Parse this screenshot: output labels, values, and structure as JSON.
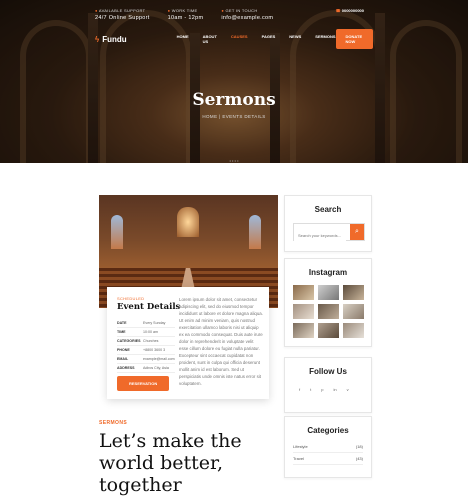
{
  "topbar": {
    "support_label": "AVAILABLE SUPPORT",
    "support_value": "24/7 Online Support",
    "work_label": "WORK TIME",
    "work_value": "10am - 12pm",
    "touch_label": "GET IN TOUCH",
    "touch_value": "info@example.com",
    "phone": "0000000000"
  },
  "nav": {
    "logo": "Fundu",
    "items": [
      "HOME",
      "ABOUT US",
      "CAUSES",
      "PAGES",
      "NEWS",
      "SERMONS"
    ],
    "active_index": 2,
    "donate": "DONATE NOW"
  },
  "hero": {
    "title": "Sermons",
    "breadcrumb": "HOME | EVENTS DETAILS",
    "dots": "• • • •"
  },
  "event": {
    "tag": "SCHEDULED",
    "title": "Event Details",
    "rows": [
      {
        "k": "DATE",
        "v": "Every Sunday"
      },
      {
        "k": "TIME",
        "v": "10:00 am"
      },
      {
        "k": "CATEGORIES",
        "v": "Churches"
      },
      {
        "k": "PHONE",
        "v": "+8800 3600 3"
      },
      {
        "k": "EMAIL",
        "v": "example@mail.com"
      },
      {
        "k": "ADDRESS",
        "v": "Adiros City, Asia"
      }
    ],
    "reserve": "RESERVATION",
    "paragraph": "Lorem ipsum dolor sit amet, consectetur adipiscing elit, sed do eiusmod tempor incididunt ut labore et dolore magna aliqua. Ut enim ad minim veniam, quis nostrud exercitation ullamco laboris nisi ut aliquip ex ea commodo consequat. Duis aute irure dolor in reprehenderit in voluptate velit esse cillum dolore eu fugiat nulla pariatur. Excepteur sint occaecat cupidatat non proident, sunt in culpa qui officia deserunt mollit anim id est laborum. Sed ut perspiciatis unde omnis iste natus error sit voluptatem."
  },
  "article": {
    "tag": "SERMONS",
    "title": "Let’s make the world better, together"
  },
  "sidebar": {
    "search_title": "Search",
    "search_placeholder": "Search your keywords...",
    "instagram_title": "Instagram",
    "follow_title": "Follow Us",
    "social": [
      "f",
      "t",
      "p",
      "in",
      "v"
    ],
    "categories_title": "Categories",
    "categories": [
      {
        "name": "Lifestyle",
        "count": "(18)"
      },
      {
        "name": "Travel",
        "count": "(43)"
      }
    ]
  },
  "colors": {
    "accent": "#f06a2a"
  }
}
